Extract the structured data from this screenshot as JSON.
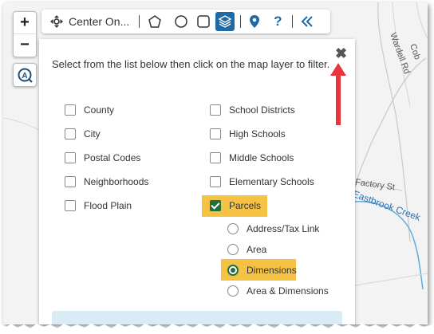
{
  "toolbar": {
    "center_on_label": "Center On...",
    "buttons": [
      "move-icon",
      "pentagon-icon",
      "circle-icon",
      "square-icon",
      "layers-icon",
      "pin-icon",
      "help-icon",
      "collapse-icon"
    ]
  },
  "zoom": {
    "in_label": "+",
    "out_label": "−"
  },
  "map": {
    "street_labels": [
      "Wardell Rd",
      "Cob",
      "Factory St"
    ],
    "creek_label": "Eastbrook Creek"
  },
  "panel": {
    "instructions": "Select from the list below then click on the map layer to filter.",
    "close_label": "✖",
    "left_options": [
      "County",
      "City",
      "Postal Codes",
      "Neighborhoods",
      "Flood Plain"
    ],
    "right_options": [
      "School Districts",
      "High Schools",
      "Middle Schools",
      "Elementary Schools",
      "Parcels"
    ],
    "parcel_options": [
      "Address/Tax Link",
      "Area",
      "Dimensions",
      "Area & Dimensions"
    ],
    "checked": "Parcels",
    "selected_parcel_option": "Dimensions"
  },
  "colors": {
    "accent": "#1f6f3a",
    "highlight": "#f6c244",
    "arrow": "#e8343b",
    "toolbar_icon": "#1c6aa8"
  }
}
